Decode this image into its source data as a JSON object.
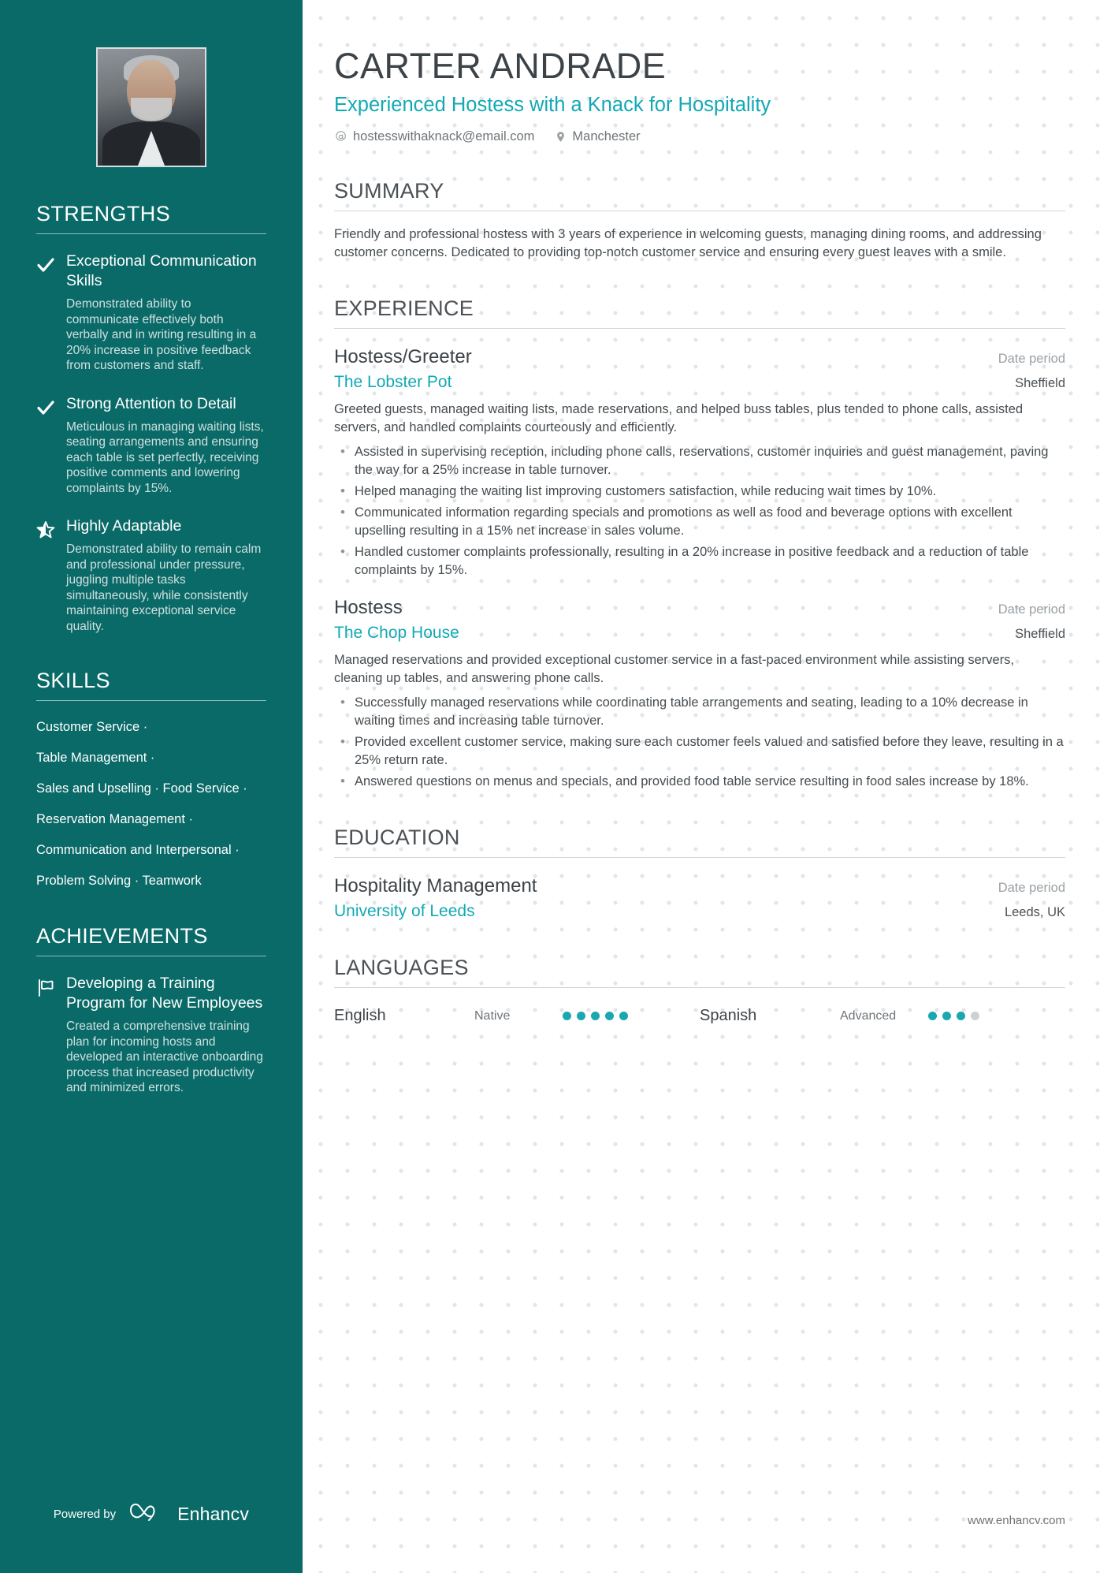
{
  "header": {
    "name": "CARTER ANDRADE",
    "headline": "Experienced Hostess with a Knack for Hospitality",
    "email": "hostesswithaknack@email.com",
    "email_icon": "at-icon",
    "location": "Manchester",
    "location_icon": "map-pin-icon"
  },
  "sidebar": {
    "photo_alt": "profile-photo",
    "strengths_heading": "STRENGTHS",
    "strengths": [
      {
        "icon": "check-icon",
        "title": "Exceptional Communication Skills",
        "description": "Demonstrated ability to communicate effectively both verbally and in writing resulting in a 20% increase in positive feedback from customers and staff."
      },
      {
        "icon": "check-icon",
        "title": "Strong Attention to Detail",
        "description": "Meticulous in managing waiting lists, seating arrangements and ensuring each table is set perfectly, receiving positive comments and lowering complaints by 15%."
      },
      {
        "icon": "star-icon",
        "title": "Highly Adaptable",
        "description": "Demonstrated ability to remain calm and professional under pressure, juggling multiple tasks simultaneously, while consistently maintaining exceptional service quality."
      }
    ],
    "skills_heading": "SKILLS",
    "skills_lines": [
      "Customer Service ·",
      "Table Management ·",
      "Sales and Upselling · Food Service ·",
      "Reservation Management ·",
      "Communication and Interpersonal ·",
      "Problem Solving · Teamwork"
    ],
    "achievements_heading": "ACHIEVEMENTS",
    "achievements": [
      {
        "icon": "flag-icon",
        "title": "Developing a Training Program for New Employees",
        "description": "Created a comprehensive training plan for incoming hosts and developed an interactive onboarding process that increased productivity and minimized errors."
      }
    ],
    "footer": {
      "powered_by": "Powered by",
      "brand": "Enhancv",
      "brand_icon": "enhancv-logo-icon"
    }
  },
  "main": {
    "summary_heading": "SUMMARY",
    "summary_text": "Friendly and professional hostess with 3 years of experience in welcoming guests, managing dining rooms, and addressing customer concerns. Dedicated to providing top-notch customer service and ensuring every guest leaves with a smile.",
    "experience_heading": "EXPERIENCE",
    "experience": [
      {
        "title": "Hostess/Greeter",
        "date": "Date period",
        "company": "The Lobster Pot",
        "location": "Sheffield",
        "description": "Greeted guests, managed waiting lists, made reservations, and helped buss tables, plus tended to phone calls, assisted servers, and handled complaints courteously and efficiently.",
        "bullets": [
          "Assisted in supervising reception, including phone calls, reservations, customer inquiries and guest management, paving the way for a 25% increase in table turnover.",
          "Helped managing the waiting list improving customers satisfaction, while reducing wait times by 10%.",
          "Communicated information regarding specials and promotions as well as food and beverage options with excellent upselling resulting in a 15% net increase in sales volume.",
          "Handled customer complaints professionally, resulting in a 20% increase in positive feedback and a reduction of table complaints by 15%."
        ]
      },
      {
        "title": "Hostess",
        "date": "Date period",
        "company": "The Chop House",
        "location": "Sheffield",
        "description": "Managed reservations and provided exceptional customer service in a fast-paced environment while assisting servers, cleaning up tables, and answering phone calls.",
        "bullets": [
          "Successfully managed reservations while coordinating table arrangements and seating, leading to a 10% decrease in waiting times and increasing table turnover.",
          "Provided excellent customer service, making sure each customer feels valued and satisfied before they leave, resulting in a 25% return rate.",
          "Answered questions on menus and specials, and provided food table service resulting in food sales increase by 18%."
        ]
      }
    ],
    "education_heading": "EDUCATION",
    "education": [
      {
        "degree": "Hospitality Management",
        "date": "Date period",
        "school": "University of Leeds",
        "location": "Leeds, UK"
      }
    ],
    "languages_heading": "LANGUAGES",
    "languages": [
      {
        "name": "English",
        "level": "Native",
        "filled": 5,
        "total": 5
      },
      {
        "name": "Spanish",
        "level": "Advanced",
        "filled": 4,
        "total": 5
      }
    ],
    "website": "www.enhancv.com"
  },
  "colors": {
    "sidebar_bg": "#0a6a68",
    "accent_teal": "#12a9b4",
    "heading_gray": "#4b5155",
    "body_gray": "#464c50"
  }
}
